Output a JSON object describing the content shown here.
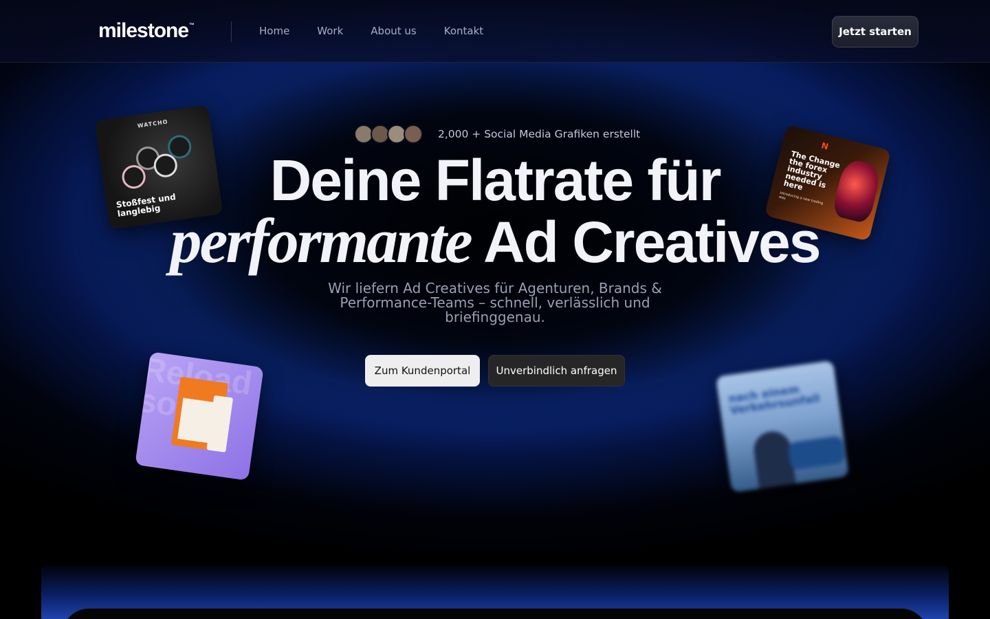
{
  "nav": {
    "logo_text": "milestone",
    "logo_mark": "™",
    "links": [
      "Home",
      "Work",
      "About us",
      "Kontakt"
    ],
    "cta_label": "Jetzt starten"
  },
  "hero": {
    "social_proof": "2,000 + Social Media Grafiken erstellt",
    "avatar_colors": [
      "#8a7a6a",
      "#6b5a48",
      "#9a8e7a",
      "#7a5e50"
    ],
    "headline_line1": "Deine Flatrate für",
    "headline_italic": "performante",
    "headline_line2_rest": "Ad Creatives",
    "subline": "Wir liefern Ad Creatives für Agenturen, Brands & Performance-Teams – schnell, verlässlich und briefinggenau.",
    "primary_button": "Zum Kundenportal",
    "secondary_button": "Unverbindlich anfragen"
  },
  "cards": {
    "watch": {
      "brand": "WATCHO",
      "caption": "Stoßfest und langlebig"
    },
    "forex": {
      "logo": "N",
      "title": "The Change the forex industry needed is here",
      "small": "Introducing a new trading way"
    },
    "reload": {
      "bg_text": "Reload solo"
    },
    "blurred": {
      "title": "nach einem Verkehrsunfall"
    }
  },
  "colors": {
    "accent_blue": "#1a46d2",
    "primary_button_bg": "#eeeeee",
    "secondary_button_bg": "#262626"
  }
}
